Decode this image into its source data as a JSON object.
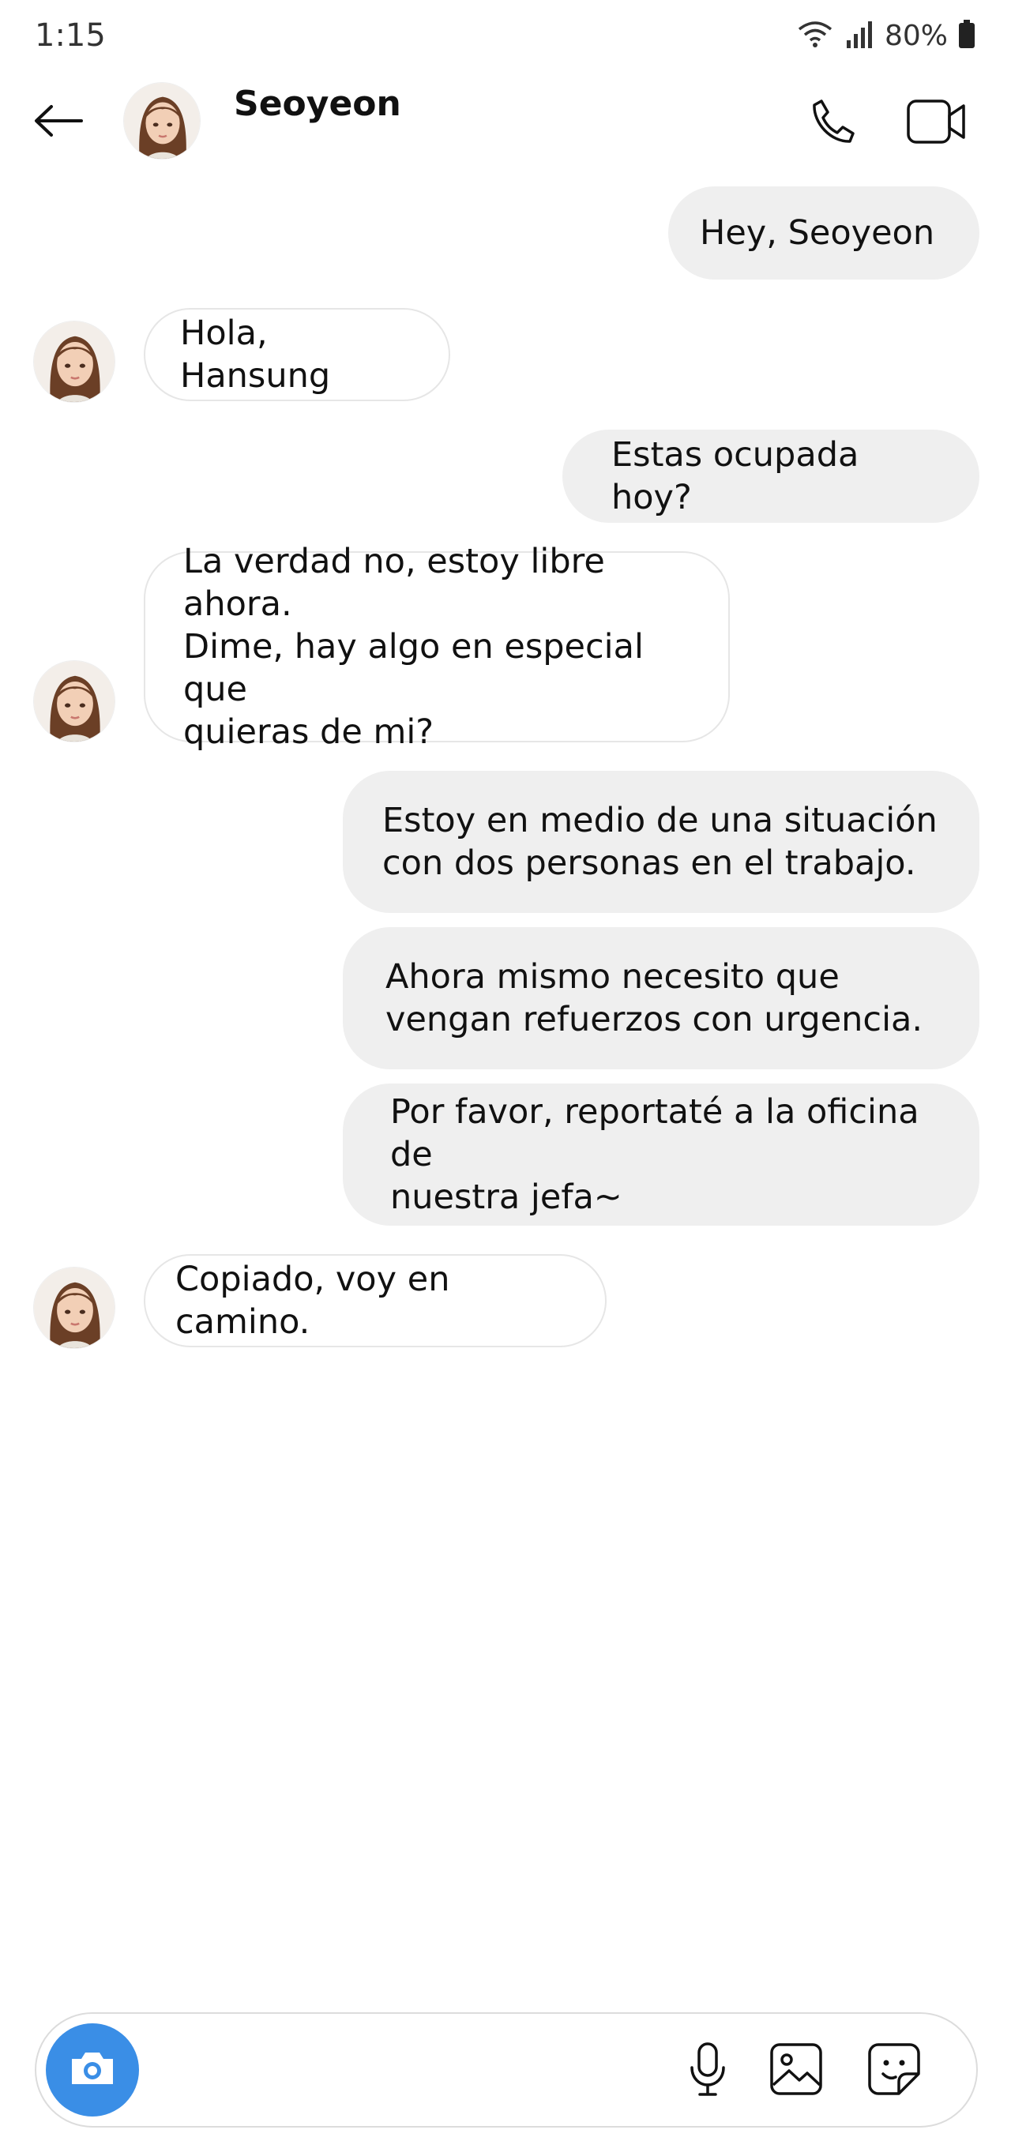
{
  "status_bar": {
    "time": "1:15",
    "battery_percent": "80%",
    "icons": [
      "wifi-icon",
      "signal-icon",
      "battery-icon"
    ]
  },
  "header": {
    "contact_name": "Seoyeon",
    "icons": [
      "back-arrow-icon",
      "avatar",
      "phone-icon",
      "video-camera-icon"
    ]
  },
  "messages": [
    {
      "direction": "sent",
      "text": "Hey, Seoyeon"
    },
    {
      "direction": "received",
      "text": "Hola, Hansung"
    },
    {
      "direction": "sent",
      "text": "Estas ocupada hoy?"
    },
    {
      "direction": "received",
      "text": "La verdad no, estoy libre ahora.\nDime, hay algo en especial que\nquieras de mi?"
    },
    {
      "direction": "sent",
      "text": "Estoy en medio de una situación\ncon dos personas en el trabajo."
    },
    {
      "direction": "sent",
      "text": "Ahora mismo necesito que\nvengan refuerzos con urgencia."
    },
    {
      "direction": "sent",
      "text": "Por favor, reportaté a la oficina de\nnuestra jefa~"
    },
    {
      "direction": "received",
      "text": "Copiado, voy en camino."
    }
  ],
  "composer": {
    "input_value": "",
    "placeholder": "",
    "icons": [
      "camera-icon",
      "microphone-icon",
      "gallery-icon",
      "sticker-icon"
    ]
  },
  "colors": {
    "sent_bubble": "#efefef",
    "received_bubble_border": "#e6e6e6",
    "camera_button": "#3a8ee6",
    "text": "#111111"
  }
}
